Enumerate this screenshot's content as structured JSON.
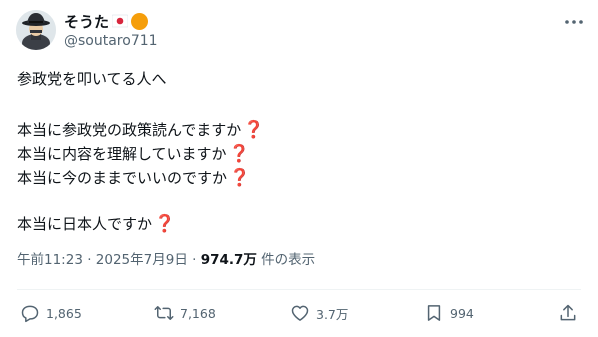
{
  "user": {
    "display_name": "そうた",
    "handle": "@soutaro711",
    "avatar_icon": "avatar-detective-icon",
    "badges": [
      "japan-flag-icon",
      "orange-circle-icon"
    ]
  },
  "tweet": {
    "lines": [
      "参政党を叩いてる人へ",
      "",
      "本当に参政党の政策読んでますか",
      "本当に内容を理解していますか",
      "本当に今のままでいいのですか",
      "",
      "本当に日本人ですか"
    ],
    "qmark": "❓"
  },
  "meta": {
    "datetime": "午前11:23 · 2025年7月9日 · ",
    "views": "974.7万",
    "views_suffix": " 件の表示"
  },
  "actions": {
    "replies": "1,865",
    "reposts": "7,168",
    "likes": "3.7万",
    "bookmarks": "994"
  },
  "colors": {
    "text": "#0f1419",
    "secondary": "#536471",
    "question": "#c5162b",
    "orange": "#f59e0b"
  }
}
